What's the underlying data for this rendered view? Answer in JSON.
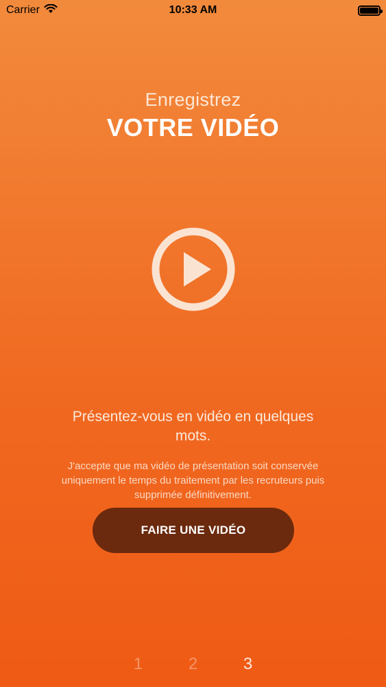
{
  "status_bar": {
    "carrier": "Carrier",
    "time": "10:33 AM",
    "battery_level": 1.0
  },
  "header": {
    "subtitle": "Enregistrez",
    "title": "VOTRE VIDÉO"
  },
  "play_button": {
    "icon": "play-circle-icon",
    "color": "#fbe3d2"
  },
  "intro_text": "Présentez-vous en vidéo en quelques mots.",
  "consent_text": "J'accepte que ma vidéo de présentation soit conservée uniquement le temps du traitement par les recruteurs puis supprimée définitivement.",
  "cta": {
    "label": "FAIRE UNE VIDÉO",
    "background": "#6b2a0d"
  },
  "pager": {
    "pages": [
      "1",
      "2",
      "3"
    ],
    "active_index": 2
  },
  "colors": {
    "background_top": "#f28a3c",
    "background_bottom": "#ef5a14"
  }
}
